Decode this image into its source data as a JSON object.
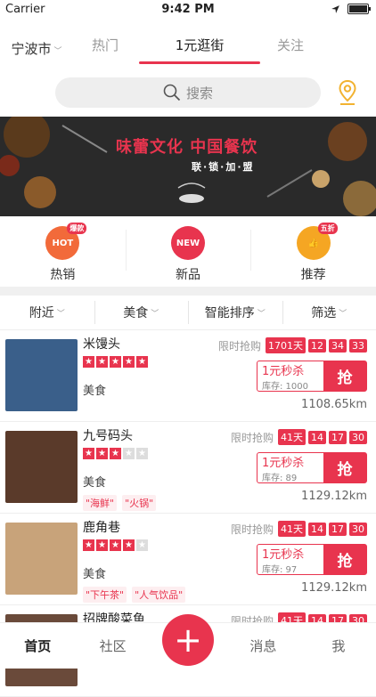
{
  "status_bar": {
    "carrier": "Carrier",
    "time": "9:42 PM"
  },
  "top_nav": {
    "city": "宁波市",
    "tabs": [
      "热门",
      "1元逛街",
      "关注"
    ],
    "active_tab": "1元逛街"
  },
  "search": {
    "placeholder": "搜索"
  },
  "banner": {
    "title": "味蕾文化 中国餐饮",
    "subtitle": "联·锁·加·盟"
  },
  "categories": [
    {
      "label": "热销",
      "icon": "hot-icon",
      "badge": "爆款",
      "icon_text": "HOT",
      "color": "#f26a3a"
    },
    {
      "label": "新品",
      "icon": "new-icon",
      "badge": "",
      "icon_text": "NEW",
      "color": "#e8344e"
    },
    {
      "label": "推荐",
      "icon": "thumbs-up-icon",
      "badge": "五折",
      "icon_text": "👍",
      "color": "#f5a623"
    }
  ],
  "filters": [
    "附近",
    "美食",
    "智能排序",
    "筛选"
  ],
  "items": [
    {
      "name": "米馒头",
      "rating": 5,
      "type": "美食",
      "tags": [],
      "countdown_label": "限时抢购",
      "days": "1701天",
      "h": "12",
      "m": "34",
      "s": "33",
      "deal_price": "1元秒杀",
      "stock": "库存: 1000",
      "grab": "抢",
      "distance": "1108.65km",
      "thumb_color": "#3a5f8a"
    },
    {
      "name": "九号码头",
      "rating": 3.5,
      "type": "美食",
      "tags": [
        "\"海鲜\"",
        "\"火锅\""
      ],
      "countdown_label": "限时抢购",
      "days": "41天",
      "h": "14",
      "m": "17",
      "s": "30",
      "deal_price": "1元秒杀",
      "stock": "库存: 89",
      "grab": "抢",
      "distance": "1129.12km",
      "thumb_color": "#5a3a2a"
    },
    {
      "name": "鹿角巷",
      "rating": 4.5,
      "type": "美食",
      "tags": [
        "\"下午茶\"",
        "\"人气饮品\""
      ],
      "countdown_label": "限时抢购",
      "days": "41天",
      "h": "14",
      "m": "17",
      "s": "30",
      "deal_price": "1元秒杀",
      "stock": "库存: 97",
      "grab": "抢",
      "distance": "1129.12km",
      "thumb_color": "#c8a37a"
    },
    {
      "name": "招牌酸菜鱼",
      "rating": 0,
      "type": "",
      "tags": [],
      "countdown_label": "限时抢购",
      "days": "41天",
      "h": "14",
      "m": "17",
      "s": "30",
      "deal_price": "",
      "stock": "",
      "grab": "",
      "distance": "",
      "thumb_color": "#6a4a3a"
    }
  ],
  "tab_bar": {
    "items": [
      "首页",
      "社区",
      "消息",
      "我"
    ],
    "active": "首页"
  }
}
